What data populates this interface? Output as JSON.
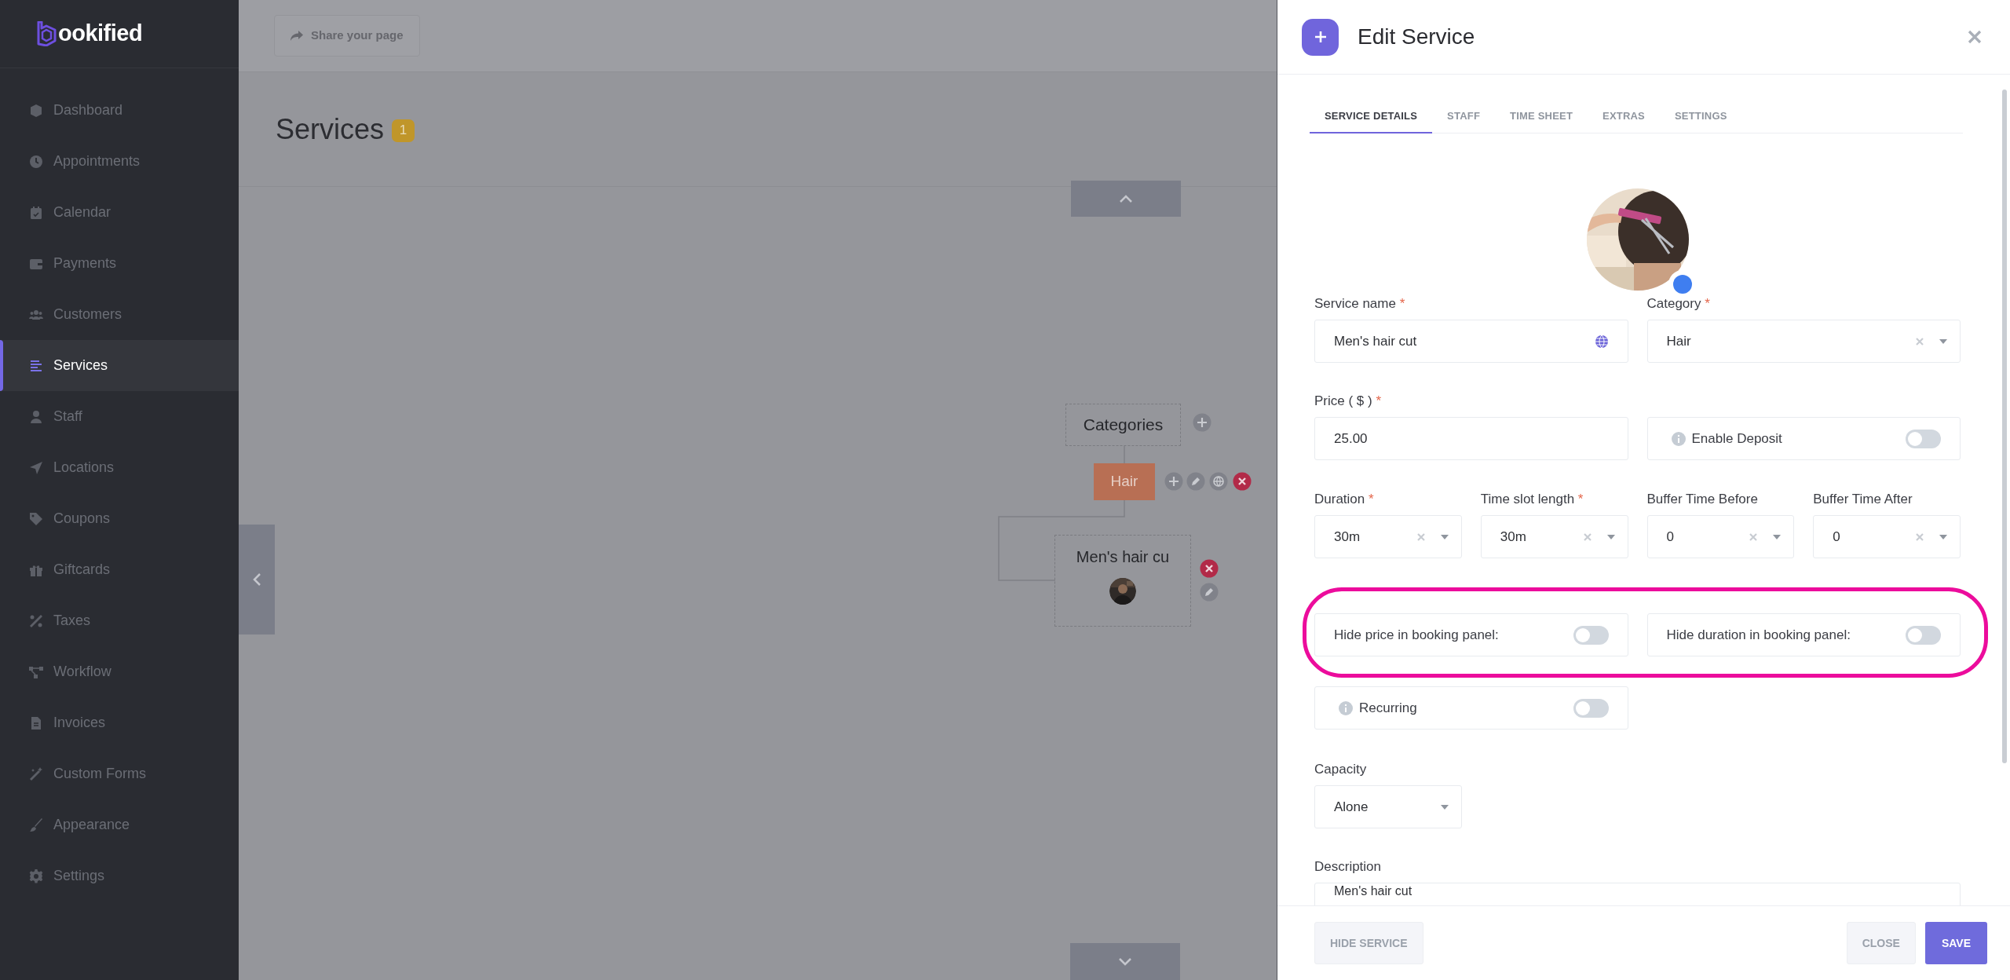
{
  "sidebar": {
    "logo": "ookified",
    "items": [
      {
        "label": "Dashboard",
        "selected": false
      },
      {
        "label": "Appointments",
        "selected": false
      },
      {
        "label": "Calendar",
        "selected": false
      },
      {
        "label": "Payments",
        "selected": false
      },
      {
        "label": "Customers",
        "selected": false
      },
      {
        "label": "Services",
        "selected": true
      },
      {
        "label": "Staff",
        "selected": false
      },
      {
        "label": "Locations",
        "selected": false
      },
      {
        "label": "Coupons",
        "selected": false
      },
      {
        "label": "Giftcards",
        "selected": false
      },
      {
        "label": "Taxes",
        "selected": false
      },
      {
        "label": "Workflow",
        "selected": false
      },
      {
        "label": "Invoices",
        "selected": false
      },
      {
        "label": "Custom Forms",
        "selected": false
      },
      {
        "label": "Appearance",
        "selected": false
      },
      {
        "label": "Settings",
        "selected": false
      }
    ]
  },
  "header": {
    "share_button": "Share your page"
  },
  "page": {
    "title": "Services",
    "count": "1"
  },
  "canvas": {
    "root": "Categories",
    "category": "Hair",
    "service": "Men's hair cu"
  },
  "panel": {
    "title": "Edit Service",
    "tabs": [
      {
        "label": "SERVICE DETAILS",
        "selected": true
      },
      {
        "label": "STAFF",
        "selected": false
      },
      {
        "label": "TIME SHEET",
        "selected": false
      },
      {
        "label": "EXTRAS",
        "selected": false
      },
      {
        "label": "SETTINGS",
        "selected": false
      }
    ],
    "rows": [
      {
        "highlighted": false,
        "fields": [
          {
            "kind": "text",
            "label": "Service name",
            "required_mark": "*",
            "value": "Men's hair cut",
            "translatable": true
          },
          {
            "kind": "select",
            "label": "Category",
            "required_mark": "*",
            "value": "Hair",
            "clearable": true
          }
        ]
      },
      {
        "highlighted": false,
        "fields": [
          {
            "kind": "text",
            "label": "Price ( $ )",
            "required_mark": "*",
            "value": "25.00"
          },
          {
            "kind": "toggle",
            "label": "Enable Deposit",
            "info": true,
            "on": false
          }
        ]
      },
      {
        "highlighted": false,
        "fields": [
          {
            "kind": "select",
            "label": "Duration",
            "required_mark": "*",
            "value": "30m",
            "clearable": true
          },
          {
            "kind": "select",
            "label": "Time slot length",
            "required_mark": "*",
            "value": "30m",
            "clearable": true
          },
          {
            "kind": "select",
            "label": "Buffer Time Before",
            "value": "0",
            "clearable": true
          },
          {
            "kind": "select",
            "label": "Buffer Time After",
            "value": "0",
            "clearable": true
          }
        ]
      },
      {
        "highlighted": true,
        "fields": [
          {
            "kind": "toggle",
            "label": "Hide price in booking panel:",
            "on": false
          },
          {
            "kind": "toggle",
            "label": "Hide duration in booking panel:",
            "on": false
          }
        ]
      },
      {
        "highlighted": false,
        "fields": [
          {
            "kind": "toggle",
            "label": "Recurring",
            "info": true,
            "on": false
          }
        ]
      },
      {
        "highlighted": false,
        "fields": [
          {
            "kind": "select",
            "label": "Capacity",
            "value": "Alone"
          }
        ]
      },
      {
        "highlighted": false,
        "fields": [
          {
            "kind": "textarea",
            "label": "Description",
            "value": "Men's hair cut"
          }
        ]
      }
    ],
    "footer": {
      "hide_button": "HIDE SERVICE",
      "close_button": "CLOSE",
      "save_button": "SAVE"
    }
  }
}
